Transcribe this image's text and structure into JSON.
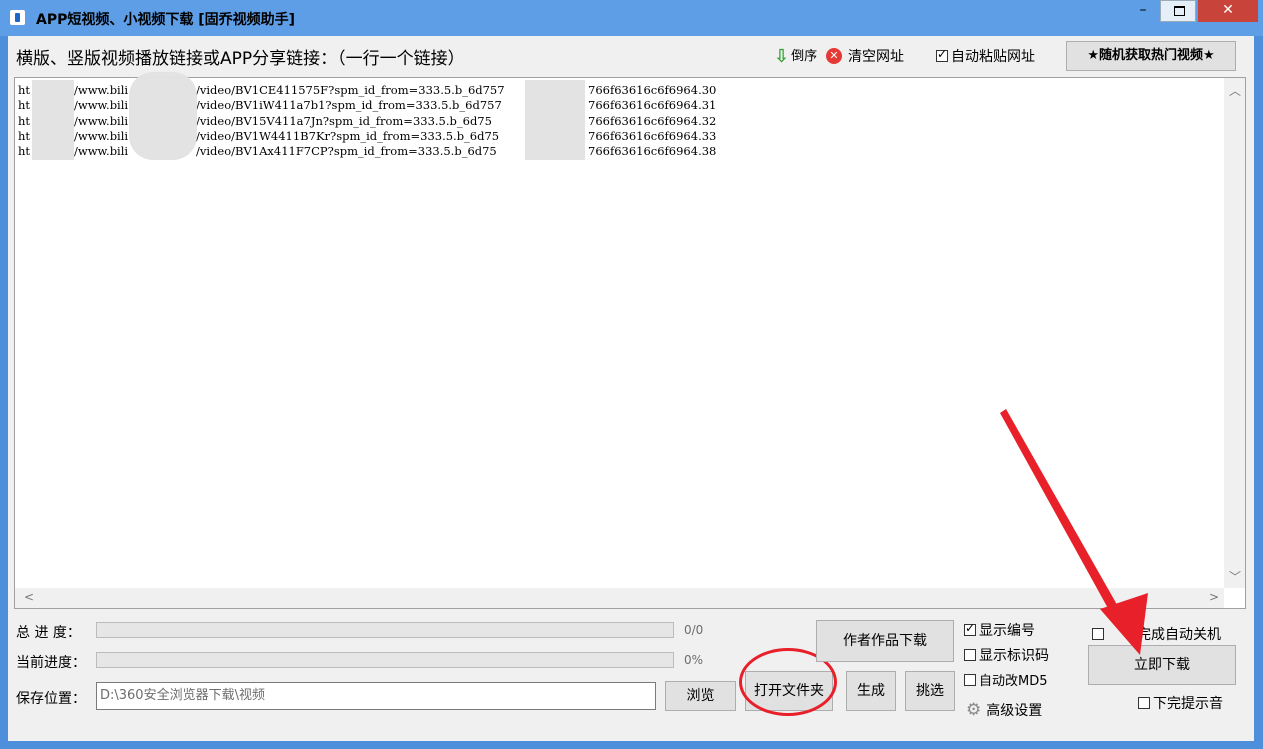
{
  "window": {
    "title": "APP短视频、小视频下载 [固乔视频助手]",
    "minimize_symbol": "–",
    "close_symbol": "✕"
  },
  "toolbar": {
    "prompt": "横版、竖版视频播放链接或APP分享链接：（一行一个链接）",
    "reverse_label": "倒序",
    "clear_label": "清空网址",
    "clear_icon_symbol": "✕",
    "auto_paste_label": "自动粘贴网址",
    "auto_paste_checked": true,
    "hot_videos_label": "★随机获取热门视频★"
  },
  "links": [
    {
      "a": "ht",
      "b": "/www.bili",
      "c": "/video/BV1CE411575F?spm_id_from=333.5.b_6d757",
      "d": "766f63616c6f6964.30"
    },
    {
      "a": "ht",
      "b": "/www.bili",
      "c": "/video/BV1iW411a7b1?spm_id_from=333.5.b_6d757",
      "d": "766f63616c6f6964.31"
    },
    {
      "a": "ht",
      "b": "/www.bili",
      "c": "/video/BV15V411a7Jn?spm_id_from=333.5.b_6d75",
      "d": "766f63616c6f6964.32"
    },
    {
      "a": "ht",
      "b": "/www.bili",
      "c": "/video/BV1W4411B7Kr?spm_id_from=333.5.b_6d75",
      "d": "766f63616c6f6964.33"
    },
    {
      "a": "ht",
      "b": "/www.bili",
      "c": "/video/BV1Ax411F7CP?spm_id_from=333.5.b_6d75",
      "d": "766f63616c6f6964.38"
    }
  ],
  "scroll": {
    "up": "︿",
    "down": "﹀",
    "left": "<",
    "right": ">"
  },
  "progress": {
    "total_label": "总 进 度：",
    "total_value": "0/0",
    "total_fraction": 0,
    "current_label": "当前进度：",
    "current_value": "0%",
    "current_fraction": 0
  },
  "save": {
    "label": "保存位置：",
    "path": "D:\\360安全浏览器下载\\视频",
    "browse_label": "浏览",
    "open_folder_label": "打开文件夹"
  },
  "actions": {
    "author_download_label": "作者作品下载",
    "generate_label": "生成",
    "filter_label": "挑选",
    "download_now_label": "立即下载"
  },
  "options": {
    "show_number_label": "显示编号",
    "show_number_checked": true,
    "show_mark_label": "显示标识码",
    "show_mark_checked": false,
    "auto_md5_label": "自动改MD5",
    "auto_md5_checked": false,
    "advanced_label": "高级设置",
    "auto_shutdown_label": "完成自动关机",
    "auto_shutdown_checked": false,
    "done_sound_label": "下完提示音",
    "done_sound_checked": false
  },
  "colors": {
    "accent_annotation": "#e8202a",
    "title_bar": "#5d9ee6",
    "close_button": "#c8433a"
  }
}
